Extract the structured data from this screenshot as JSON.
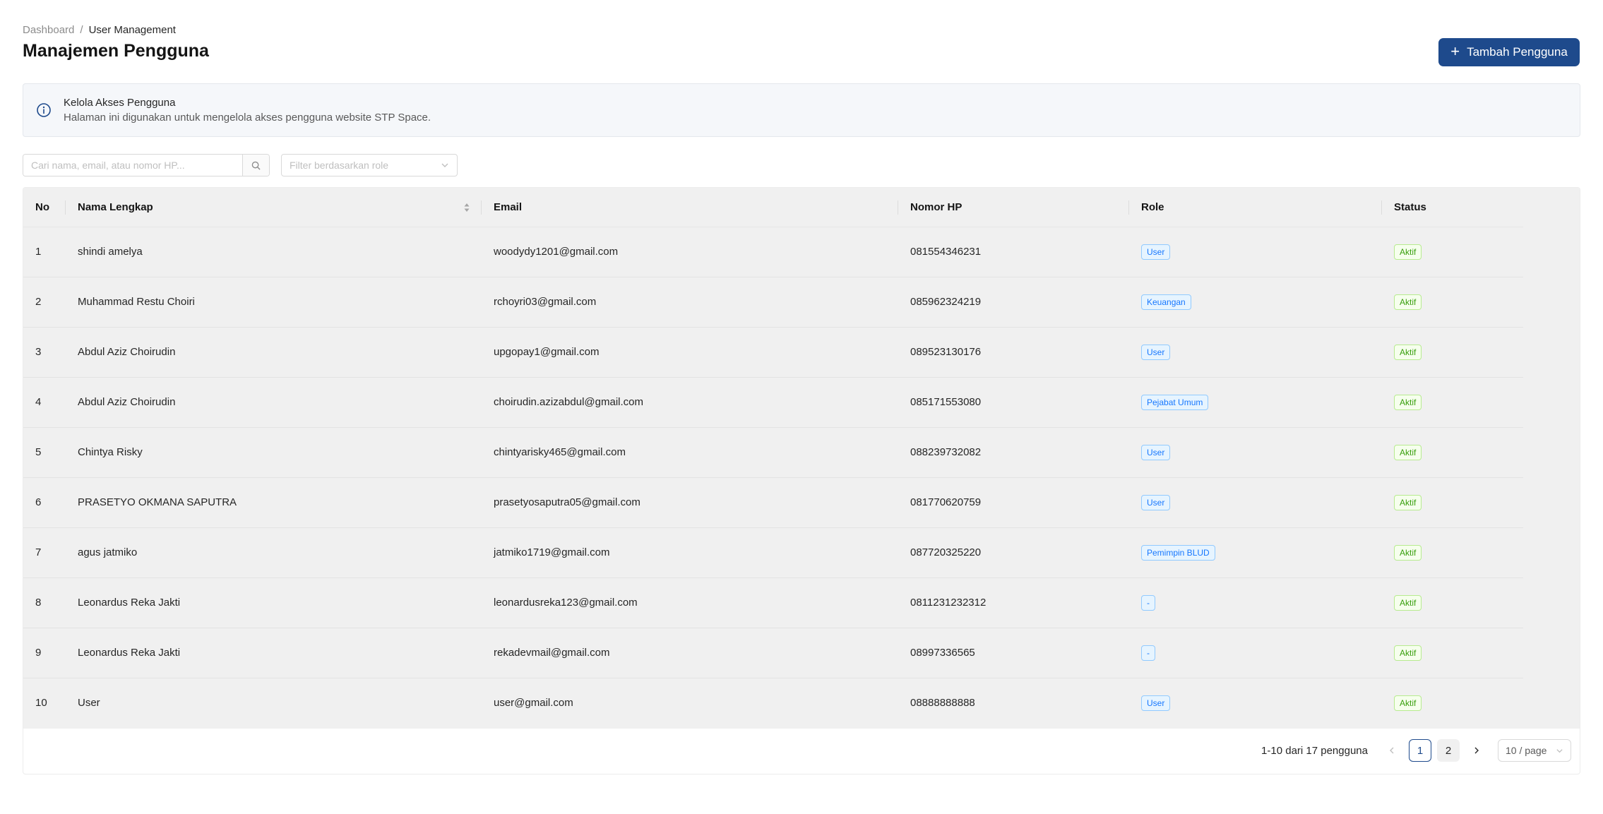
{
  "breadcrumb": {
    "home": "Dashboard",
    "separator": "/",
    "current": "User Management"
  },
  "page_title": "Manajemen Pengguna",
  "add_button": {
    "label": "Tambah Pengguna",
    "icon": "plus-icon"
  },
  "info": {
    "icon": "info-circle-icon",
    "title": "Kelola Akses Pengguna",
    "description": "Halaman ini digunakan untuk mengelola akses pengguna website STP Space."
  },
  "search": {
    "placeholder": "Cari nama, email, atau nomor HP...",
    "icon": "search-icon"
  },
  "role_filter": {
    "placeholder": "Filter berdasarkan role",
    "icon": "chevron-down-icon"
  },
  "table": {
    "columns": [
      "No",
      "Nama Lengkap",
      "Email",
      "Nomor HP",
      "Role",
      "Status"
    ],
    "rows": [
      {
        "no": "1",
        "name": "shindi amelya",
        "email": "woodydy1201@gmail.com",
        "phone": "081554346231",
        "role": "User",
        "status": "Aktif"
      },
      {
        "no": "2",
        "name": "Muhammad Restu Choiri",
        "email": "rchoyri03@gmail.com",
        "phone": "085962324219",
        "role": "Keuangan",
        "status": "Aktif"
      },
      {
        "no": "3",
        "name": "Abdul Aziz Choirudin",
        "email": "upgopay1@gmail.com",
        "phone": "089523130176",
        "role": "User",
        "status": "Aktif"
      },
      {
        "no": "4",
        "name": "Abdul Aziz Choirudin",
        "email": "choirudin.azizabdul@gmail.com",
        "phone": "085171553080",
        "role": "Pejabat Umum",
        "status": "Aktif"
      },
      {
        "no": "5",
        "name": "Chintya Risky",
        "email": "chintyarisky465@gmail.com",
        "phone": "088239732082",
        "role": "User",
        "status": "Aktif"
      },
      {
        "no": "6",
        "name": "PRASETYO OKMANA SAPUTRA",
        "email": "prasetyosaputra05@gmail.com",
        "phone": "081770620759",
        "role": "User",
        "status": "Aktif"
      },
      {
        "no": "7",
        "name": "agus jatmiko",
        "email": "jatmiko1719@gmail.com",
        "phone": "087720325220",
        "role": "Pemimpin BLUD",
        "status": "Aktif"
      },
      {
        "no": "8",
        "name": "Leonardus Reka Jakti",
        "email": "leonardusreka123@gmail.com",
        "phone": "0811231232312",
        "role": "-",
        "status": "Aktif"
      },
      {
        "no": "9",
        "name": "Leonardus Reka Jakti",
        "email": "rekadevmail@gmail.com",
        "phone": "08997336565",
        "role": "-",
        "status": "Aktif"
      },
      {
        "no": "10",
        "name": "User",
        "email": "user@gmail.com",
        "phone": "08888888888",
        "role": "User",
        "status": "Aktif"
      }
    ]
  },
  "pagination": {
    "total_text": "1-10 dari 17 pengguna",
    "pages": [
      "1",
      "2"
    ],
    "current_page": "1",
    "page_size": "10 / page"
  },
  "colors": {
    "primary": "#1e4a8c",
    "role_tag": "#1677ff",
    "status_tag": "#389e0d"
  }
}
